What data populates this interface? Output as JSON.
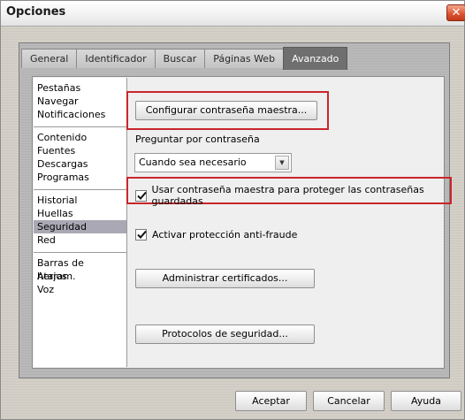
{
  "window": {
    "title": "Opciones",
    "close_glyph": "✕"
  },
  "tabs": [
    {
      "label": "General"
    },
    {
      "label": "Identificador"
    },
    {
      "label": "Buscar"
    },
    {
      "label": "Páginas Web"
    },
    {
      "label": "Avanzado",
      "active": true
    }
  ],
  "sidebar": {
    "groups": [
      [
        "Pestañas",
        "Navegar",
        "Notificaciones"
      ],
      [
        "Contenido",
        "Fuentes",
        "Descargas",
        "Programas"
      ],
      [
        "Historial",
        "Huellas",
        "Seguridad",
        "Red"
      ],
      [
        "Barras de herram.",
        "Atajos",
        "Voz"
      ]
    ],
    "selected": "Seguridad"
  },
  "security": {
    "master_password_button": "Configurar contraseña maestra...",
    "ask_password_label": "Preguntar por contraseña",
    "ask_password_select": "Cuando sea necesario",
    "use_master_password_checkbox": "Usar contraseña maestra para proteger las contraseñas guardadas",
    "use_master_password_checked": true,
    "anti_fraud_checkbox": "Activar protección anti-fraude",
    "anti_fraud_checked": true,
    "manage_certificates_button": "Administrar certificados...",
    "security_protocols_button": "Protocolos de seguridad..."
  },
  "footer": {
    "ok": "Aceptar",
    "cancel": "Cancelar",
    "help": "Ayuda"
  },
  "colors": {
    "highlight_border": "#c8262b",
    "active_tab": "#6f6f6f",
    "selected_nav": "#aaa8b4"
  }
}
